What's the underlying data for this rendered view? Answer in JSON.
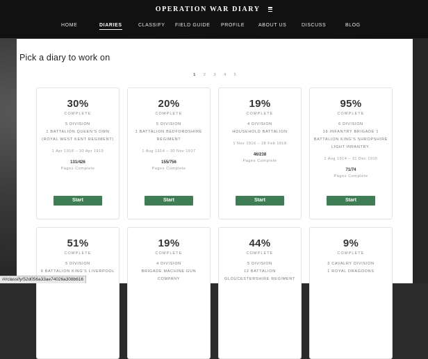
{
  "header": {
    "brand": "OPERATION WAR DIARY",
    "nav": [
      {
        "label": "HOME",
        "active": false
      },
      {
        "label": "DIARIES",
        "active": true
      },
      {
        "label": "CLASSIFY",
        "active": false
      },
      {
        "label": "FIELD GUIDE",
        "active": false
      },
      {
        "label": "PROFILE",
        "active": false
      },
      {
        "label": "ABOUT US",
        "active": false
      },
      {
        "label": "DISCUSS",
        "active": false
      },
      {
        "label": "BLOG",
        "active": false
      }
    ]
  },
  "main": {
    "heading": "Pick a diary to work on",
    "pages": [
      "1",
      "2",
      "3",
      "4",
      "5"
    ],
    "current_page": "1",
    "cards": [
      {
        "percent": "30%",
        "complete": "COMPLETE",
        "division": "5 DIVISION",
        "unit": "1 BATTALION QUEEN'S OWN (ROYAL WEST KENT REGIMENT)",
        "dates": "1 Apr 1918 – 30 Apr 1919",
        "pages": "131/426",
        "pages_label": "Pages Complete",
        "button": "Start"
      },
      {
        "percent": "20%",
        "complete": "COMPLETE",
        "division": "5 DIVISION",
        "unit": "1 BATTALION BEDFORDSHIRE REGIMENT",
        "dates": "1 Aug 1914 – 30 Nov 1917",
        "pages": "155/756",
        "pages_label": "Pages Complete",
        "button": "Start"
      },
      {
        "percent": "19%",
        "complete": "COMPLETE",
        "division": "4 DIVISION",
        "unit": "HOUSEHOLD BATTALION",
        "dates": "1 Nov 1916 – 28 Feb 1918",
        "pages": "46/238",
        "pages_label": "Pages Complete",
        "button": "Start"
      },
      {
        "percent": "95%",
        "complete": "COMPLETE",
        "division": "6 DIVISION",
        "unit": "16 INFANTRY BRIGADE 1 BATTALION KING'S SHROPSHIRE LIGHT INFANTRY.",
        "dates": "1 Aug 1914 – 31 Dec 1915",
        "pages": "71/74",
        "pages_label": "Pages Complete",
        "button": "Start"
      },
      {
        "percent": "51%",
        "complete": "COMPLETE",
        "division": "5 DIVISION",
        "unit": "6 BATTALION KING'S LIVERPOOL",
        "dates": "",
        "pages": "",
        "pages_label": "",
        "button": ""
      },
      {
        "percent": "19%",
        "complete": "COMPLETE",
        "division": "4 DIVISION",
        "unit": "BRIGADE MACHINE GUN COMPANY",
        "dates": "",
        "pages": "",
        "pages_label": "",
        "button": ""
      },
      {
        "percent": "44%",
        "complete": "COMPLETE",
        "division": "5 DIVISION",
        "unit": "12 BATTALION GLOUCESTERSHIRE REGIMENT",
        "dates": "",
        "pages": "",
        "pages_label": "",
        "button": ""
      },
      {
        "percent": "9%",
        "complete": "COMPLETE",
        "division": "3 CAVALRY DIVISION",
        "unit": "1 ROYAL DRAGOONS",
        "dates": "",
        "pages": "",
        "pages_label": "",
        "button": ""
      }
    ]
  },
  "status_url": "/#/classify/52d056a33ae74026a308b616",
  "colors": {
    "accent_button": "#3f7d55",
    "topbar": "#111111"
  }
}
